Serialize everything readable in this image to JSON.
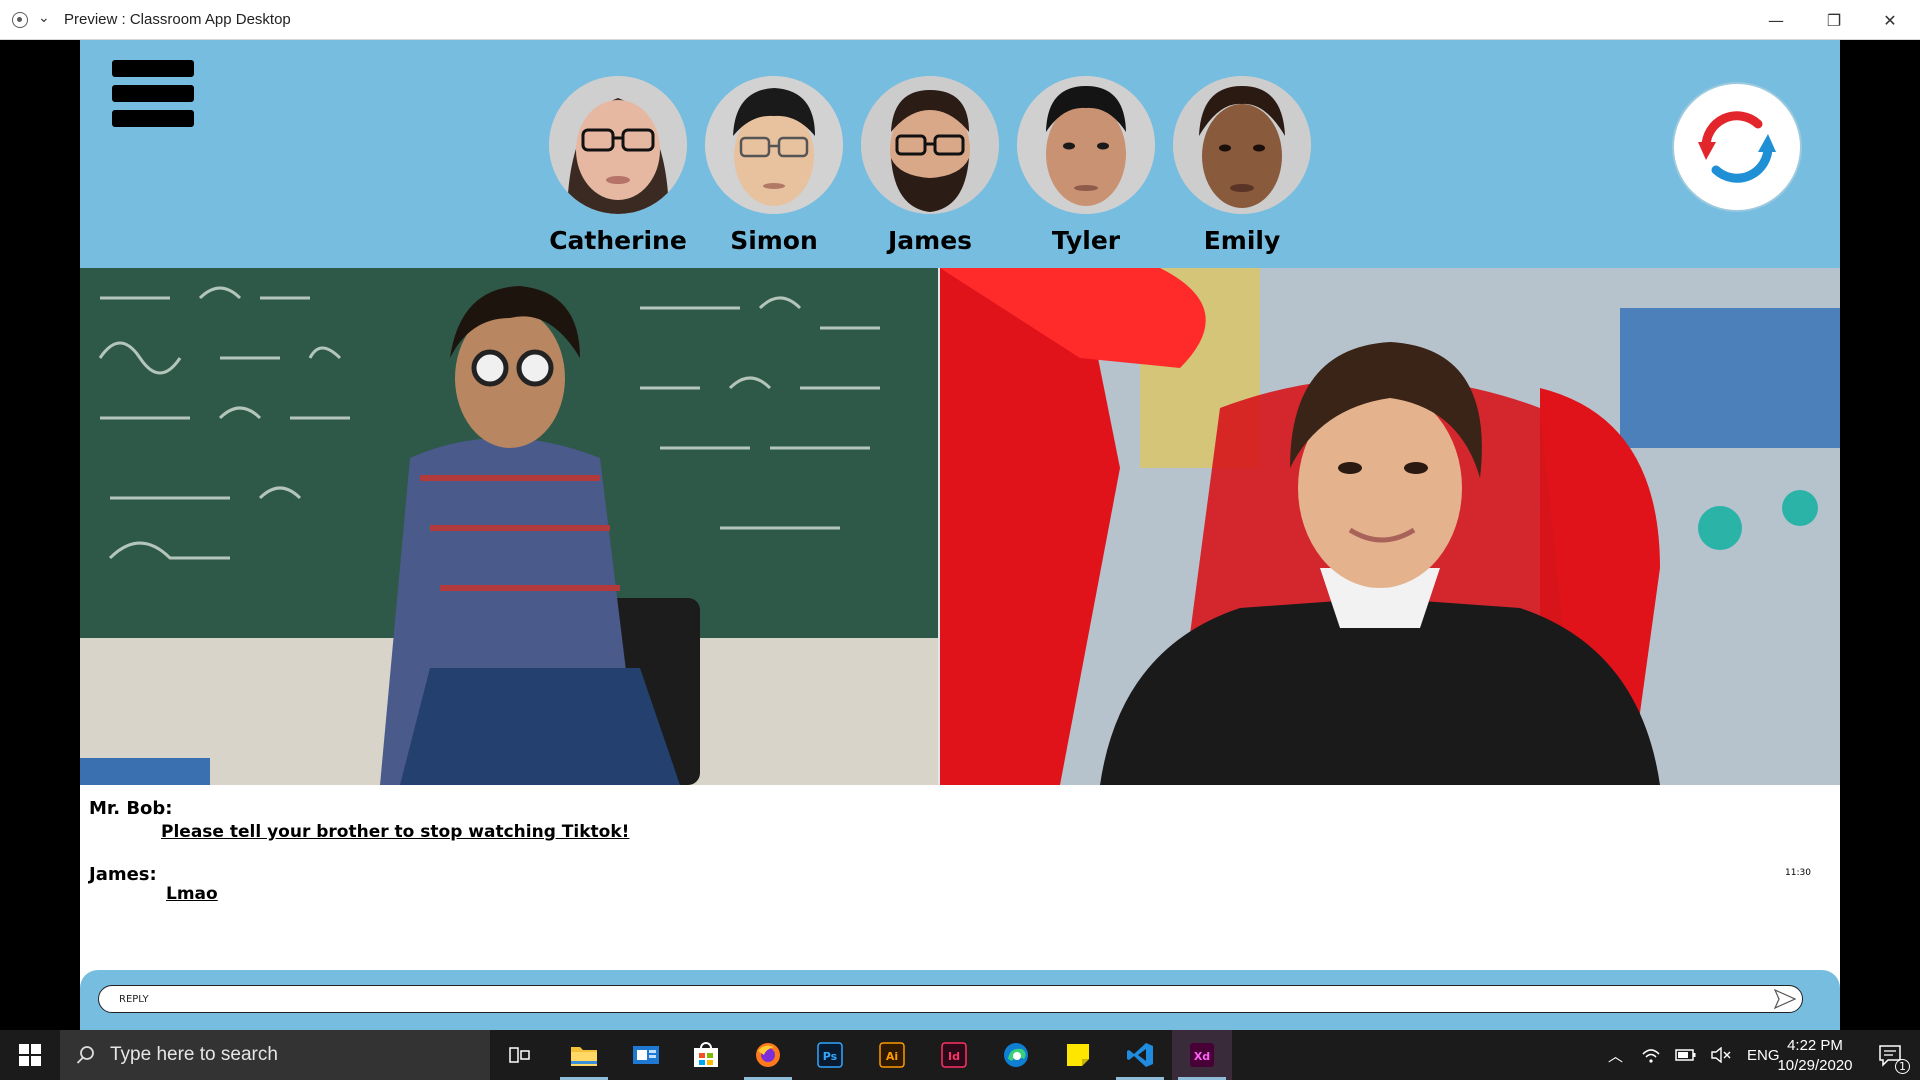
{
  "window": {
    "title": "Preview : Classroom App Desktop"
  },
  "students": [
    {
      "name": "Catherine"
    },
    {
      "name": "Simon"
    },
    {
      "name": "James"
    },
    {
      "name": "Tyler"
    },
    {
      "name": "Emily"
    }
  ],
  "chat": {
    "messages": [
      {
        "sender": "Mr. Bob:",
        "text": "Please tell your brother to stop watching Tiktok!"
      },
      {
        "sender": "James:",
        "text": "Lmao"
      }
    ],
    "timestamp": "11:30"
  },
  "reply": {
    "placeholder": "REPLY"
  },
  "taskbar": {
    "search_placeholder": "Type here to search",
    "apps": [
      "task-view",
      "file-explorer",
      "outlook",
      "store",
      "firefox",
      "photoshop",
      "illustrator",
      "indesign",
      "edge",
      "sticky-notes",
      "vscode",
      "adobe-xd"
    ],
    "tray_language": "ENG",
    "time": "4:22 PM",
    "date": "10/29/2020",
    "notification_count": "1"
  },
  "colors": {
    "header_bg": "#76bde0",
    "refresh_red": "#e3262b",
    "refresh_blue": "#1f8fd6"
  }
}
